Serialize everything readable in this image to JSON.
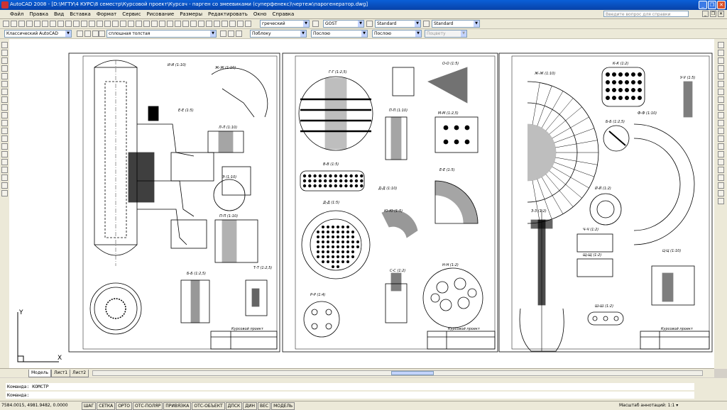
{
  "window": {
    "title": "AutoCAD 2008 - [D:\\МГТУ\\4 КУРС\\8 семестр\\Курсовой проект\\Курсач - парген со змеевиками (суперфенекс)\\чертеж\\парогенератор.dwg]"
  },
  "menu": [
    "Файл",
    "Правка",
    "Вид",
    "Вставка",
    "Формат",
    "Сервис",
    "Рисование",
    "Размеры",
    "Редактировать",
    "Окно",
    "Справка"
  ],
  "help": {
    "placeholder": "Введите вопрос для справки"
  },
  "toolbar1": {
    "text_style": "греческий",
    "dim_style": "GOST",
    "table_style": "Standard",
    "mleader_style": "Standard"
  },
  "toolbar2": {
    "workspace": "Классический AutoCAD",
    "layer": "сплошная толстая",
    "color": "Поблоку",
    "linetype": "Послою",
    "lineweight": "Послою",
    "plotstyle": "Поцвету"
  },
  "tabs": [
    "Модель",
    "Лист1",
    "Лист2"
  ],
  "command": {
    "line1": "Команда:  КОМСТР",
    "line2": "Команда:"
  },
  "status": {
    "coords": "7584.0015, 4981.9482, 0.0000",
    "buttons": [
      "ШАГ",
      "СЕТКА",
      "ОРТО",
      "ОТС-ПОЛЯР",
      "ПРИВЯЗКА",
      "ОТС-ОБЪЕКТ",
      "ДПСК",
      "ДИН",
      "ВЕС",
      "МОДЕЛЬ"
    ],
    "scale_label": "Масштаб аннотаций:",
    "scale_value": "1:1"
  },
  "ucs": {
    "x": "X",
    "y": "Y"
  },
  "drawing": {
    "sheet1_labels": [
      "И-И (1:10)",
      "Ж-Ж (1:10)",
      "Е-Е (1:5)",
      "Л-Л (1:10)",
      "Э (1:10)",
      "П-П (1:10)",
      "Б-Б (1:2,5)",
      "Т-Т (1:2,5)"
    ],
    "sheet2_labels": [
      "Г-Г (1:2,5)",
      "Д-Д (1:5)",
      "О-О (1:5)",
      "П-П (1:10)",
      "М-М (1:2,5)",
      "В-В (1:5)",
      "Д-Д (1:10)",
      "Ю-Ю (1:5)",
      "Е-Е (1:5)",
      "С-С (1:2)",
      "Р-Р (1:4)",
      "Н-Н (1:2)"
    ],
    "sheet3_labels": [
      "Ж-Ж (1:10)",
      "К-К (1:2)",
      "У-У (1:5)",
      "Ф-Ф (1:10)",
      "Б-Б (1:2,5)",
      "Й-Й (1:2)",
      "З-З (1:2)",
      "Ч-Ч (1:2)",
      "Щ-Щ (1:2)",
      "Ш-Ш (1:2)",
      "Ц-Ц (1:10)"
    ],
    "stamp_label": "Курсовой проект"
  }
}
